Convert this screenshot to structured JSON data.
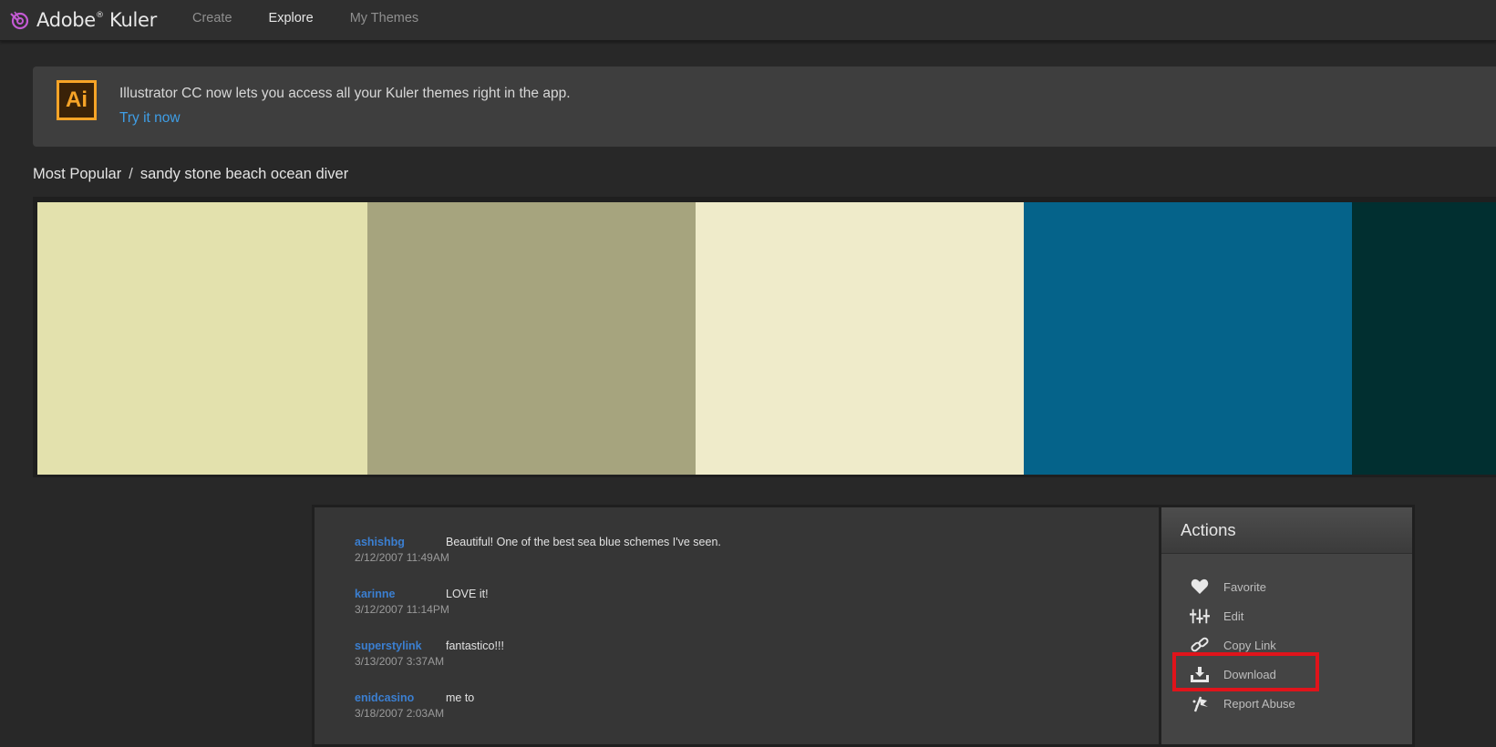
{
  "app": {
    "name": "Adobe",
    "reg": "®",
    "product": "Kuler",
    "accent_color": "#c35ad3"
  },
  "nav": {
    "tabs": [
      {
        "label": "Create",
        "active": false
      },
      {
        "label": "Explore",
        "active": true
      },
      {
        "label": "My Themes",
        "active": false
      }
    ]
  },
  "banner": {
    "icon_text": "Ai",
    "message": "Illustrator CC now lets you access all your Kuler themes right in the app.",
    "link": "Try it now",
    "link_color": "#3f9ee6"
  },
  "breadcrumb": {
    "section": "Most Popular",
    "separator": "/",
    "theme_name": "sandy stone beach ocean diver"
  },
  "theme": {
    "swatches": [
      "#e3e1ad",
      "#a6a47e",
      "#efebca",
      "#05638a",
      "#012f30"
    ]
  },
  "comments": [
    {
      "user": "ashishbg",
      "text": "Beautiful! One of the best sea blue schemes I've seen.",
      "date": "2/12/2007 11:49AM"
    },
    {
      "user": "karinne",
      "text": "LOVE it!",
      "date": "3/12/2007 11:14PM"
    },
    {
      "user": "superstylink",
      "text": "fantastico!!!",
      "date": "3/13/2007 3:37AM"
    },
    {
      "user": "enidcasino",
      "text": "me to",
      "date": "3/18/2007 2:03AM"
    }
  ],
  "actions": {
    "title": "Actions",
    "items": [
      {
        "label": "Favorite",
        "icon": "heart-icon"
      },
      {
        "label": "Edit",
        "icon": "sliders-icon"
      },
      {
        "label": "Copy Link",
        "icon": "link-icon"
      },
      {
        "label": "Download",
        "icon": "download-icon",
        "highlighted": true
      },
      {
        "label": "Report Abuse",
        "icon": "flag-icon"
      }
    ],
    "highlight_color": "#e0141b"
  }
}
